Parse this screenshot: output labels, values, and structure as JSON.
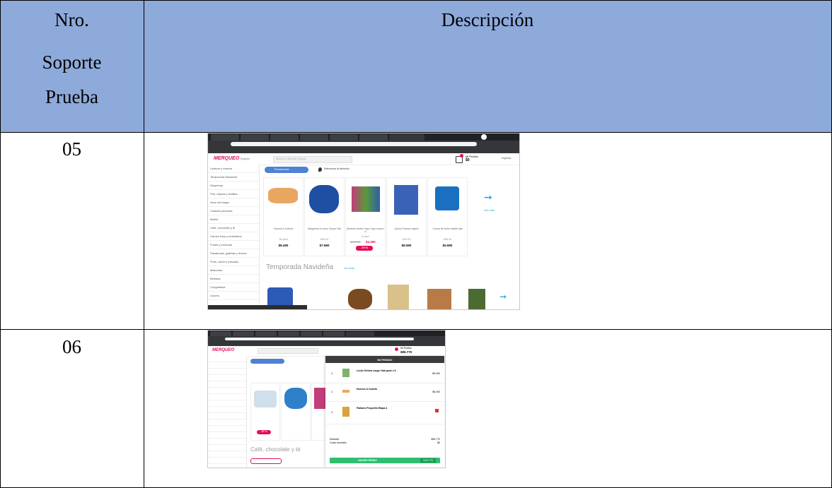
{
  "header": {
    "col1_lines": [
      "Nro.",
      "Soporte",
      "Prueba"
    ],
    "col2": "Descripción"
  },
  "rows": [
    {
      "number": "05",
      "screenshot": {
        "logo": "MERQUEO",
        "city": "Bogotá",
        "search_placeholder": "Buscar en Merqueo Bogotá",
        "cart_label": "Mi Pedido",
        "cart_total": "$0",
        "login": "Ingresa",
        "banner": "Promociones",
        "delivery_address": "Selecciona la dirección",
        "sidebar": [
          "Lácteos y huevos",
          "Temporada Navideña",
          "Despensa",
          "Pan, arepas y tortillas",
          "Aseo del hogar",
          "Cuidado personal",
          "Bebés",
          "Café, chocolate y té",
          "Carnes frías y embutidos",
          "Frutas y verduras",
          "Pasabocas, galletas y dulces",
          "Pollo, carne y pescado",
          "Mascotas",
          "Bebidas",
          "Congelados",
          "Licores"
        ],
        "products": [
          {
            "name": "Huevos A Cubeta",
            "size": "30 und",
            "price": "$8.490"
          },
          {
            "name": "Margarina en tarro Campi Vita",
            "size": "450 Gr",
            "price": "$7.690"
          },
          {
            "name": "Alimento lácteo Yogo Yogo bolsa x 6",
            "size": "6 und",
            "old_price": "$14.990",
            "price": "$4.390",
            "discount": "-70 %"
          },
          {
            "name": "Queso Finesse tajado",
            "size": "220 Gr",
            "price": "$8.590"
          },
          {
            "name": "Crema de leche Nestlé lata",
            "size": "295 Gr",
            "price": "$5.990"
          }
        ],
        "see_more": "Ver más",
        "section_title": "Temporada Navideña",
        "see_all": "Ver todo"
      }
    },
    {
      "number": "06",
      "screenshot": {
        "logo": "MERQUEO",
        "cart_label": "Mi Pedido",
        "cart_total": "$95.770",
        "panel_title": "MI PEDIDO",
        "items": [
          {
            "qty": "1",
            "name": "Leche Entera Larga Vida pack x 6",
            "price": "$9.990"
          },
          {
            "qty": "1",
            "name": "Huevos A Cubeta",
            "price": "$8.490"
          },
          {
            "qty": "2",
            "name": "Pañales Pequeñín Etapa 4",
            "price": "$77.290"
          }
        ],
        "subtotal_label": "Subtotal",
        "subtotal": "$95.770",
        "delivery_label": "Costo domicilio",
        "delivery": "$0",
        "pay_button": "HACER PEDIDO",
        "pay_amount": "$ 95.770",
        "section_title": "Café, chocolate y té",
        "discount": "-55 %"
      }
    }
  ]
}
